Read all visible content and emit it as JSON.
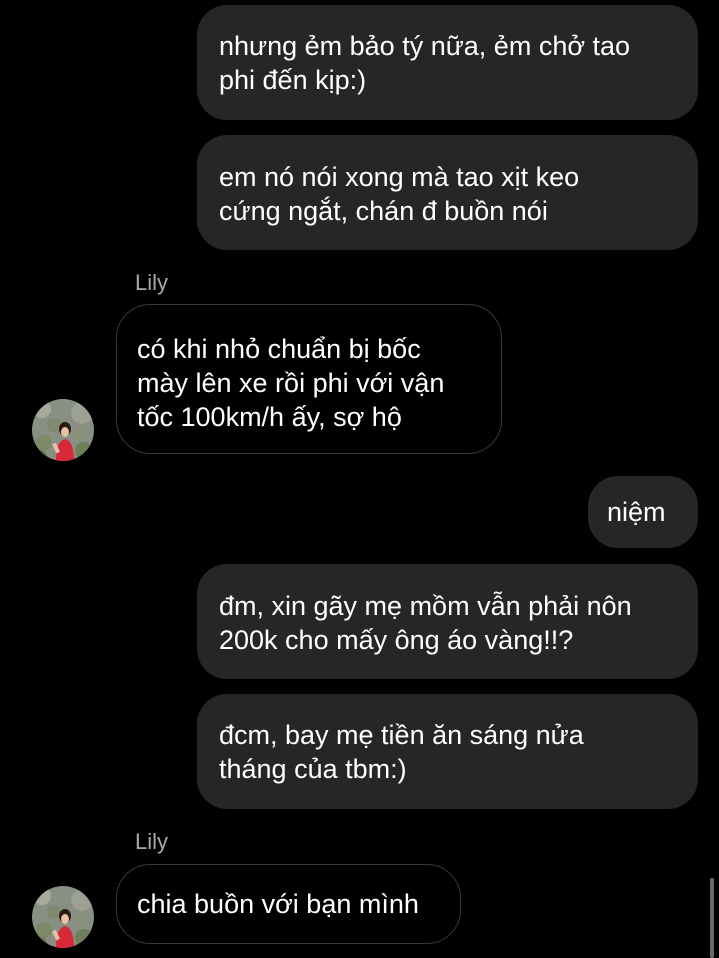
{
  "chat": {
    "messages": [
      {
        "from": "me",
        "text": "nhưng ẻm bảo tý nữa, ẻm chở tao\nphi đến kịp:)"
      },
      {
        "from": "me",
        "text": "em nó nói xong mà tao xịt keo\ncứng ngắt, chán đ buồn nói"
      },
      {
        "from": "Lily",
        "sender_label": "Lily",
        "text": "có khi nhỏ chuẩn bị bốc\nmày lên xe rồi phi với vận\ntốc 100km/h ấy, sợ hộ"
      },
      {
        "from": "me",
        "text": "niệm"
      },
      {
        "from": "me",
        "text": "đm, xin gãy mẹ mồm vẫn phải nôn\n200k cho mấy ông áo vàng!!?"
      },
      {
        "from": "me",
        "text": "đcm, bay mẹ tiền ăn sáng nửa\ntháng của tbm:)"
      },
      {
        "from": "Lily",
        "sender_label": "Lily",
        "text": "chia buồn với bạn mình"
      }
    ]
  },
  "colors": {
    "background": "#000000",
    "sent_bubble": "#262626",
    "received_border": "#3a3a3a",
    "sender_label": "#a8a8a8",
    "text": "#ffffff"
  },
  "icons": {
    "avatar": "profile-photo-avatar"
  }
}
